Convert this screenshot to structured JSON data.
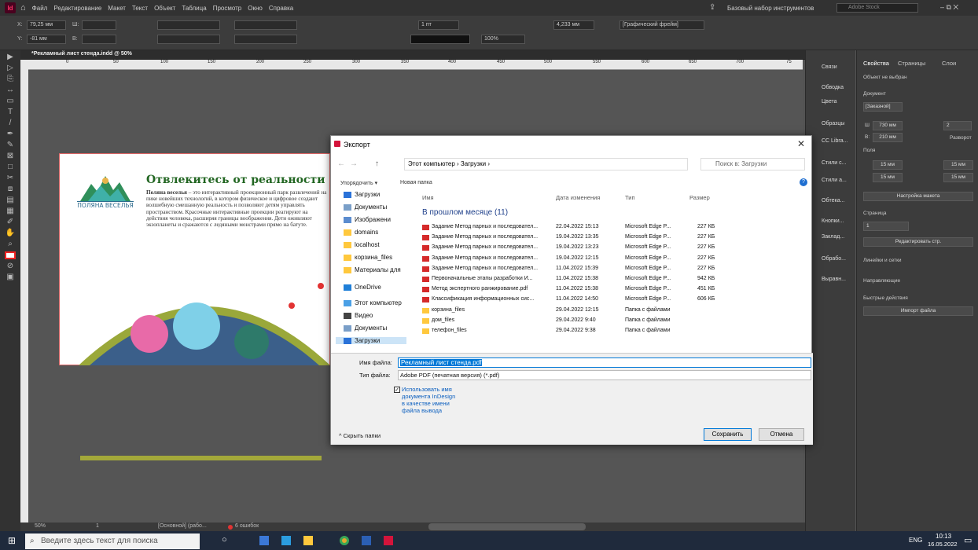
{
  "app": {
    "logo": "Id",
    "menu": [
      "Файл",
      "Редактирование",
      "Макет",
      "Текст",
      "Объект",
      "Таблица",
      "Просмотр",
      "Окно",
      "Справка"
    ],
    "workspace": "Базовый набор инструментов",
    "search_placeholder": "Adobe Stock",
    "control": {
      "x_label": "X:",
      "x_value": "79,25 мм",
      "y_label": "Y:",
      "y_value": "-81 мм",
      "w_label": "Ш:",
      "h_label": "В:",
      "stroke_pt": "1 пт",
      "zoom": "100%",
      "size_mm": "4,233 мм",
      "frame_style": "[Графический фрейм]"
    }
  },
  "document": {
    "tab": "*Рекламный лист стенда.indd @ 50%",
    "ruler_labels": [
      "0",
      "50",
      "100",
      "150",
      "200",
      "250",
      "300",
      "350",
      "400",
      "450",
      "500",
      "550",
      "600",
      "650",
      "700",
      "75"
    ],
    "logo_text": "ПОЛЯНА ВЕСЕЛЬЯ",
    "headline": "Отвлекитесь от реальности",
    "body_lead": "Поляна веселья",
    "body": " – это интерактивный проекционный парк развлечений на пике новейших технологий, в котором физическое и цифровое создают волшебную смешанную реальность и позволяют детям управлять пространством. Красочные интерактивные проекции реагируют на действия человека, расширяя границы воображения. Дети оживляют экзопланеты и сражаются с ледяными монстрами прямо на батуте.",
    "status_zoom": "50%",
    "status_page": "1",
    "status_style": "[Основной] (рабо...",
    "status_errors": "6 ошибок"
  },
  "side_panels": {
    "items": [
      "Связи",
      "Обводка",
      "Цвета",
      "Образцы",
      "CC Libra...",
      "Стили с...",
      "Стили а...",
      "Обтека...",
      "Кнопки...",
      "Заклад...",
      "Обрабо...",
      "Выравн..."
    ]
  },
  "properties": {
    "tabs": [
      "Свойства",
      "Страницы",
      "Слои"
    ],
    "no_selection": "Объект не выбран",
    "document_label": "Документ",
    "preset": "[Заказной]",
    "width_label": "Ш",
    "width": "730 мм",
    "height_label": "В:",
    "height": "210 мм",
    "pages_count": "2",
    "facing_pages": "Разворот",
    "margins_label": "Поля",
    "margin_value": "15 мм",
    "adjust_layout": "Настройка макета",
    "page_label": "Страница",
    "page_value": "1",
    "edit_page": "Редактировать стр.",
    "rulers_grids": "Линейки и сетки",
    "guides": "Направляющие",
    "quick_actions": "Быстрые действия",
    "import_file": "Импорт файла"
  },
  "dialog": {
    "title": "Экспорт",
    "breadcrumb": "Этот компьютер  ›  Загрузки  ›",
    "search_placeholder": "Поиск в: Загрузки",
    "organize": "Упорядочить ▾",
    "new_folder": "Новая папка",
    "nav": [
      {
        "label": "Загрузки",
        "color": "#2a72d8"
      },
      {
        "label": "Документы",
        "color": "#7a9fc8"
      },
      {
        "label": "Изображени",
        "color": "#5b8ccf"
      },
      {
        "label": "domains",
        "color": "#ffc83d"
      },
      {
        "label": "localhost",
        "color": "#ffc83d"
      },
      {
        "label": "корзина_files",
        "color": "#ffc83d"
      },
      {
        "label": "Материалы для",
        "color": "#ffc83d"
      },
      {
        "label": "OneDrive",
        "color": "#1f7fd8"
      },
      {
        "label": "Этот компьютер",
        "color": "#4aa0e6"
      },
      {
        "label": "Видео",
        "color": "#444"
      },
      {
        "label": "Документы",
        "color": "#7a9fc8"
      },
      {
        "label": "Загрузки",
        "color": "#2a72d8"
      }
    ],
    "columns": {
      "name": "Имя",
      "date": "Дата изменения",
      "type": "Тип",
      "size": "Размер"
    },
    "group": "В прошлом месяце (11)",
    "files": [
      {
        "kind": "pdf",
        "name": "Задание Метод парных и последовател...",
        "date": "22.04.2022 15:13",
        "type": "Microsoft Edge P...",
        "size": "227 КБ"
      },
      {
        "kind": "pdf",
        "name": "Задание Метод парных и последовател...",
        "date": "19.04.2022 13:35",
        "type": "Microsoft Edge P...",
        "size": "227 КБ"
      },
      {
        "kind": "pdf",
        "name": "Задание Метод парных и последовател...",
        "date": "19.04.2022 13:23",
        "type": "Microsoft Edge P...",
        "size": "227 КБ"
      },
      {
        "kind": "pdf",
        "name": "Задание Метод парных и последовател...",
        "date": "19.04.2022 12:15",
        "type": "Microsoft Edge P...",
        "size": "227 КБ"
      },
      {
        "kind": "pdf",
        "name": "Задание Метод парных и последовател...",
        "date": "11.04.2022 15:39",
        "type": "Microsoft Edge P...",
        "size": "227 КБ"
      },
      {
        "kind": "pdf",
        "name": "Первоначальные этапы разработки И...",
        "date": "11.04.2022 15:38",
        "type": "Microsoft Edge P...",
        "size": "942 КБ"
      },
      {
        "kind": "pdf",
        "name": "Метод экспертного ранжирование.pdf",
        "date": "11.04.2022 15:38",
        "type": "Microsoft Edge P...",
        "size": "451 КБ"
      },
      {
        "kind": "pdf",
        "name": "Классификация информационных сис...",
        "date": "11.04.2022 14:50",
        "type": "Microsoft Edge P...",
        "size": "606 КБ"
      },
      {
        "kind": "folder",
        "name": "корзина_files",
        "date": "29.04.2022 12:15",
        "type": "Папка с файлами",
        "size": ""
      },
      {
        "kind": "folder",
        "name": "дом_files",
        "date": "29.04.2022 9:40",
        "type": "Папка с файлами",
        "size": ""
      },
      {
        "kind": "folder",
        "name": "телефон_files",
        "date": "29.04.2022 9:38",
        "type": "Папка с файлами",
        "size": ""
      }
    ],
    "filename_label": "Имя файла:",
    "filename": "Рекламный лист стенда.pdf",
    "filetype_label": "Тип файла:",
    "filetype": "Adobe PDF (печатная версия) (*.pdf)",
    "checkbox": "Использовать имя документа InDesign в качестве имени файла вывода",
    "hide_folders": "Скрыть папки",
    "save": "Сохранить",
    "cancel": "Отмена"
  },
  "taskbar": {
    "search": "Введите здесь текст для поиска",
    "lang": "ENG",
    "time": "10:13",
    "date": "16.05.2022"
  }
}
